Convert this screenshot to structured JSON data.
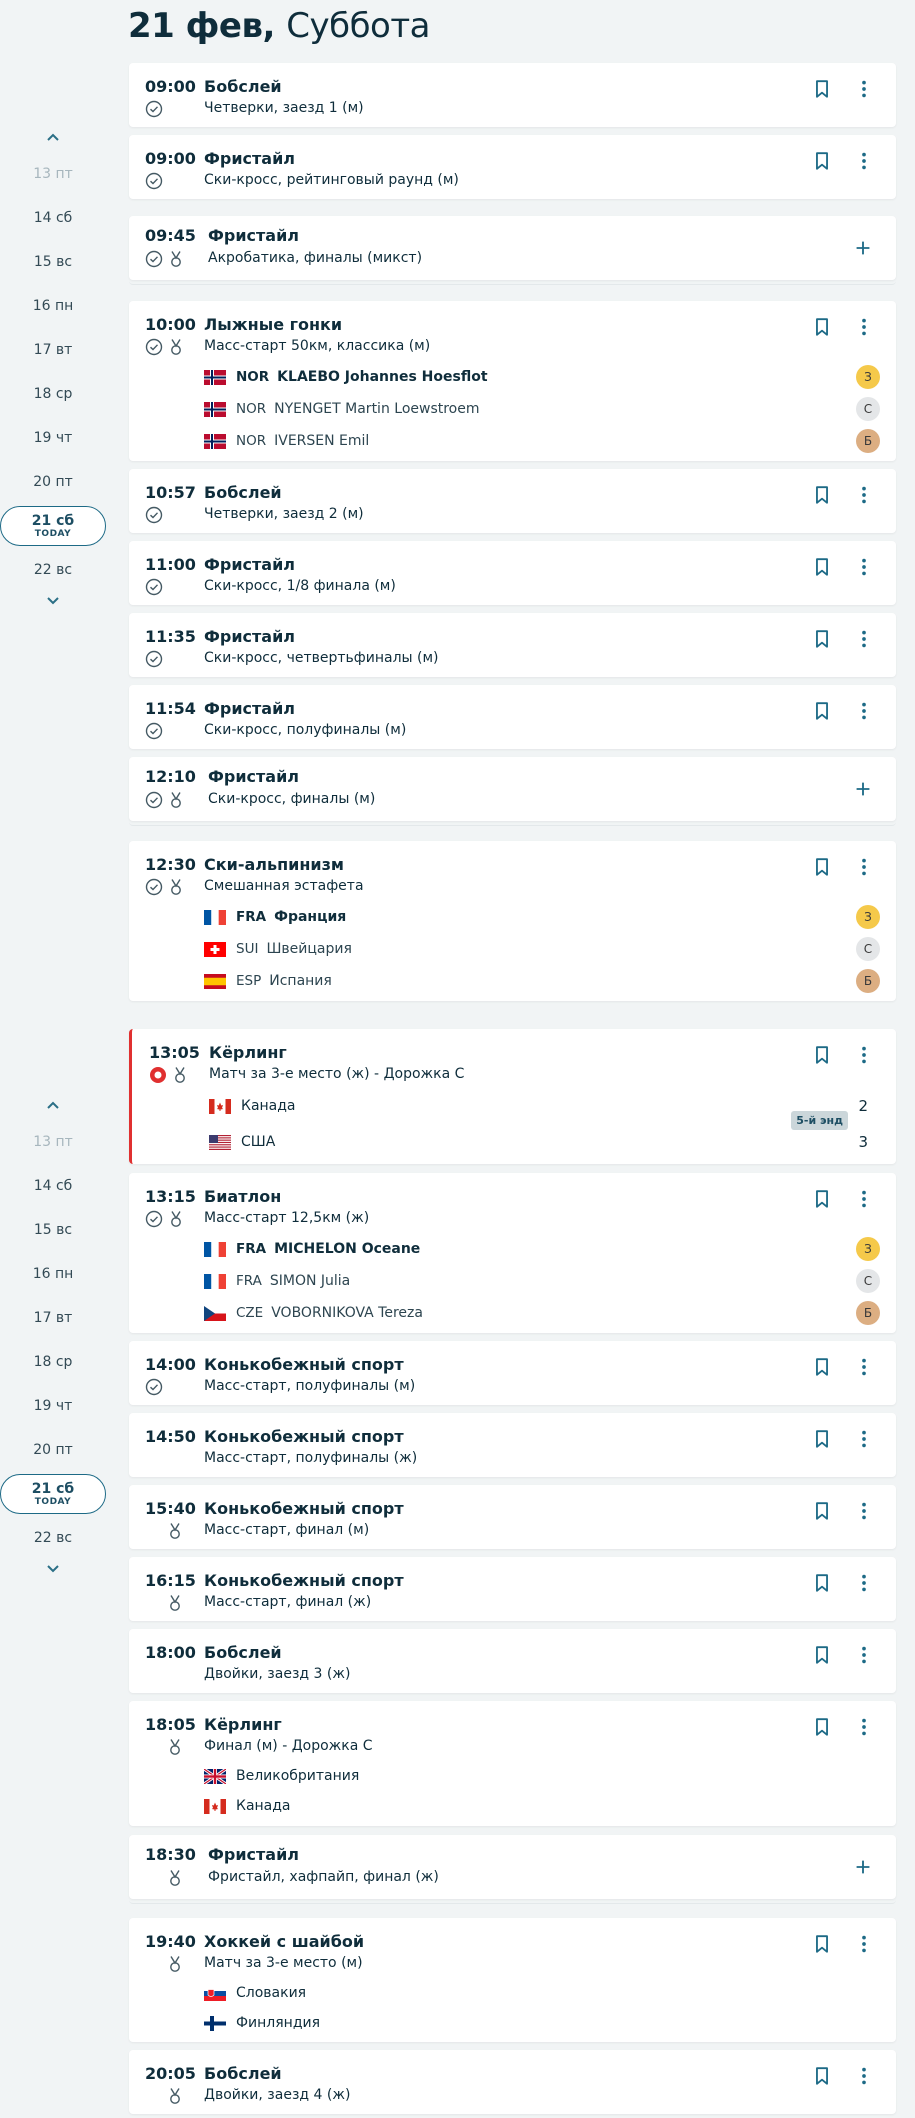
{
  "header": {
    "day": "21 фев,",
    "weekday": "Суббота"
  },
  "sidebar": {
    "days": [
      {
        "label": "13 пт",
        "muted": true
      },
      {
        "label": "14 сб"
      },
      {
        "label": "15 вс"
      },
      {
        "label": "16 пн"
      },
      {
        "label": "17 вт"
      },
      {
        "label": "18 ср"
      },
      {
        "label": "19 чт"
      },
      {
        "label": "20 пт"
      },
      {
        "label": "21 сб",
        "today": true,
        "today_label": "TODAY"
      },
      {
        "label": "22 вс"
      }
    ]
  },
  "events": [
    {
      "time": "09:00",
      "sport": "Бобслей",
      "event": "Четверки, заезд 1 (м)"
    },
    {
      "time": "09:00",
      "sport": "Фристайл",
      "event": "Ски-кросс, рейтинговый раунд (м)"
    },
    {
      "time": "09:45",
      "sport": "Фристайл",
      "event": "Акробатика, финалы (микст)"
    },
    {
      "time": "10:00",
      "sport": "Лыжные гонки",
      "event": "Масс-старт 50км, классика (м)",
      "results": [
        {
          "code": "NOR",
          "name": "KLAEBO Johannes Hoesflot",
          "medal": "З"
        },
        {
          "code": "NOR",
          "name": "NYENGET Martin Loewstroem",
          "medal": "С"
        },
        {
          "code": "NOR",
          "name": "IVERSEN Emil",
          "medal": "Б"
        }
      ]
    },
    {
      "time": "10:57",
      "sport": "Бобслей",
      "event": "Четверки, заезд 2 (м)"
    },
    {
      "time": "11:00",
      "sport": "Фристайл",
      "event": "Ски-кросс, 1/8 финала (м)"
    },
    {
      "time": "11:35",
      "sport": "Фристайл",
      "event": "Ски-кросс, четвертьфиналы (м)"
    },
    {
      "time": "11:54",
      "sport": "Фристайл",
      "event": "Ски-кросс, полуфиналы (м)"
    },
    {
      "time": "12:10",
      "sport": "Фристайл",
      "event": "Ски-кросс, финалы (м)"
    },
    {
      "time": "12:30",
      "sport": "Ски-альпинизм",
      "event": "Смешанная эстафета",
      "results": [
        {
          "code": "FRA",
          "name": "Франция",
          "medal": "З"
        },
        {
          "code": "SUI",
          "name": "Швейцария",
          "medal": "С"
        },
        {
          "code": "ESP",
          "name": "Испания",
          "medal": "Б"
        }
      ]
    },
    {
      "time": "13:05",
      "sport": "Кёрлинг",
      "event": "Матч за 3-е место (ж) - Дорожка C",
      "teams": [
        {
          "name": "Канада",
          "score": "2"
        },
        {
          "name": "США",
          "score": "3"
        }
      ],
      "end_tag": "5-й энд"
    },
    {
      "time": "13:15",
      "sport": "Биатлон",
      "event": "Масс-старт 12,5км (ж)",
      "results": [
        {
          "code": "FRA",
          "name": "MICHELON Oceane",
          "medal": "З"
        },
        {
          "code": "FRA",
          "name": "SIMON Julia",
          "medal": "С"
        },
        {
          "code": "CZE",
          "name": "VOBORNIKOVA Tereza",
          "medal": "Б"
        }
      ]
    },
    {
      "time": "14:00",
      "sport": "Конькобежный спорт",
      "event": "Масс-старт, полуфиналы (м)"
    },
    {
      "time": "14:50",
      "sport": "Конькобежный спорт",
      "event": "Масс-старт, полуфиналы (ж)"
    },
    {
      "time": "15:40",
      "sport": "Конькобежный спорт",
      "event": "Масс-старт, финал (м)"
    },
    {
      "time": "16:15",
      "sport": "Конькобежный спорт",
      "event": "Масс-старт, финал (ж)"
    },
    {
      "time": "18:00",
      "sport": "Бобслей",
      "event": "Двойки, заезд 3 (ж)"
    },
    {
      "time": "18:05",
      "sport": "Кёрлинг",
      "event": "Финал (м) - Дорожка C",
      "teams": [
        {
          "name": "Великобритания"
        },
        {
          "name": "Канада"
        }
      ]
    },
    {
      "time": "18:30",
      "sport": "Фристайл",
      "event": "Фристайл, хафпайп, финал (ж)"
    },
    {
      "time": "19:40",
      "sport": "Хоккей с шайбой",
      "event": "Матч за 3-е место (м)",
      "teams": [
        {
          "name": "Словакия"
        },
        {
          "name": "Финляндия"
        }
      ]
    },
    {
      "time": "20:05",
      "sport": "Бобслей",
      "event": "Двойки, заезд 4 (ж)"
    }
  ]
}
